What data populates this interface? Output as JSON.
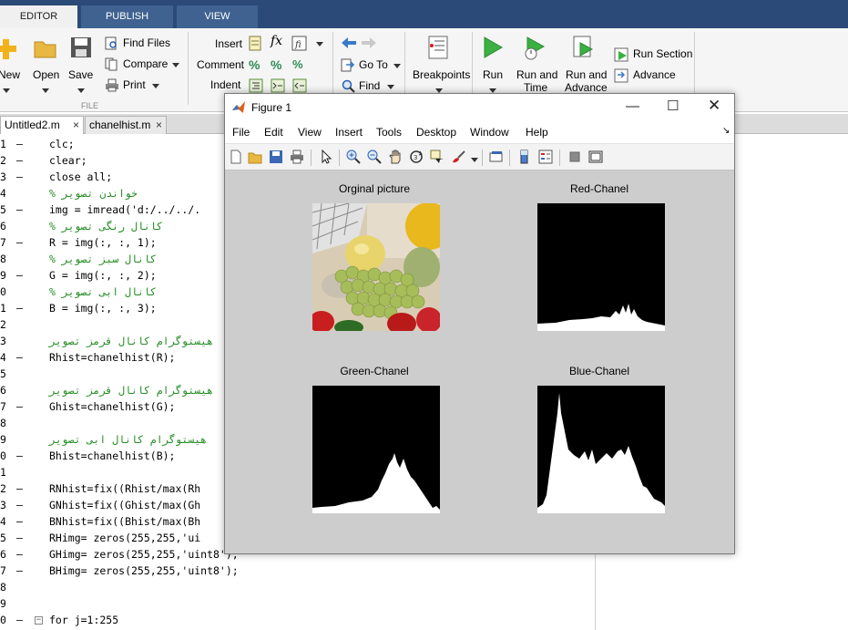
{
  "tabs": [
    "EDITOR",
    "PUBLISH",
    "VIEW"
  ],
  "ribbon": {
    "file_group": {
      "new": "New",
      "open": "Open",
      "save": "Save",
      "find_files": "Find Files",
      "compare": "Compare",
      "print": "Print",
      "group_label": "FILE"
    },
    "edit_group": {
      "insert": "Insert",
      "comment": "Comment",
      "indent": "Indent",
      "fx": "fx"
    },
    "nav_group": {
      "go_to": "Go To",
      "find": "Find"
    },
    "breakpoints": "Breakpoints",
    "run": "Run",
    "run_and_time": [
      "Run and",
      "Time"
    ],
    "run_and_advance": [
      "Run and",
      "Advance"
    ],
    "run_section": "Run Section",
    "advance": "Advance"
  },
  "file_tabs": [
    {
      "name": "Untitled2.m",
      "active": true
    },
    {
      "name": "chanelhist.m",
      "active": false
    }
  ],
  "editor_lines": [
    {
      "num": "1",
      "code": "clc;"
    },
    {
      "num": "2",
      "code": "clear;"
    },
    {
      "num": "3",
      "code": "close all;"
    },
    {
      "num": "4",
      "code": "% خواندن تصویر"
    },
    {
      "num": "5",
      "code": "img = imread('d:/../../."
    },
    {
      "num": "6",
      "code": "% کانال رنگی تصویر"
    },
    {
      "num": "7",
      "code": "R = img(:, :, 1);"
    },
    {
      "num": "8",
      "code": "% کانال سبز تصویر"
    },
    {
      "num": "9",
      "code": "G = img(:, :, 2);"
    },
    {
      "num": "0",
      "code": "% کانال ابی تصویر"
    },
    {
      "num": "1",
      "code": "B = img(:, :, 3);"
    },
    {
      "num": "2",
      "code": ""
    },
    {
      "num": "3",
      "code": "هیستوگرام کانال قرمز تصویر"
    },
    {
      "num": "4",
      "code": "Rhist=chanelhist(R);"
    },
    {
      "num": "5",
      "code": ""
    },
    {
      "num": "6",
      "code": "هیستوگرام کانال قرمز تصویر"
    },
    {
      "num": "7",
      "code": "Ghist=chanelhist(G);"
    },
    {
      "num": "8",
      "code": ""
    },
    {
      "num": "9",
      "code": "هیستوگرام کانال ابی تصویر"
    },
    {
      "num": "0",
      "code": "Bhist=chanelhist(B);"
    },
    {
      "num": "1",
      "code": ""
    },
    {
      "num": "2",
      "code": "RNhist=fix((Rhist/max(Rh"
    },
    {
      "num": "3",
      "code": "GNhist=fix((Ghist/max(Gh"
    },
    {
      "num": "4",
      "code": "BNhist=fix((Bhist/max(Bh"
    },
    {
      "num": "5",
      "code": "RHimg= zeros(255,255,'ui"
    },
    {
      "num": "6",
      "code": "GHimg= zeros(255,255,'uint8');"
    },
    {
      "num": "7",
      "code": "BHimg= zeros(255,255,'uint8');"
    },
    {
      "num": "8",
      "code": ""
    },
    {
      "num": "9",
      "code": ""
    },
    {
      "num": "0",
      "code": "for j=1:255"
    }
  ],
  "figure": {
    "title": "Figure 1",
    "menu": [
      "File",
      "Edit",
      "View",
      "Insert",
      "Tools",
      "Desktop",
      "Window",
      "Help"
    ],
    "panels": [
      {
        "title": "Orginal picture"
      },
      {
        "title": "Red-Chanel"
      },
      {
        "title": "Green-Chanel"
      },
      {
        "title": "Blue-Chanel"
      }
    ]
  },
  "colors": {
    "tab_strip": "#2b4a78",
    "ribbon": "#f5f5f5",
    "comment": "#228b22",
    "string": "#a020f0",
    "keyword": "#0000ff",
    "figure_bg": "#cdcdcd"
  }
}
